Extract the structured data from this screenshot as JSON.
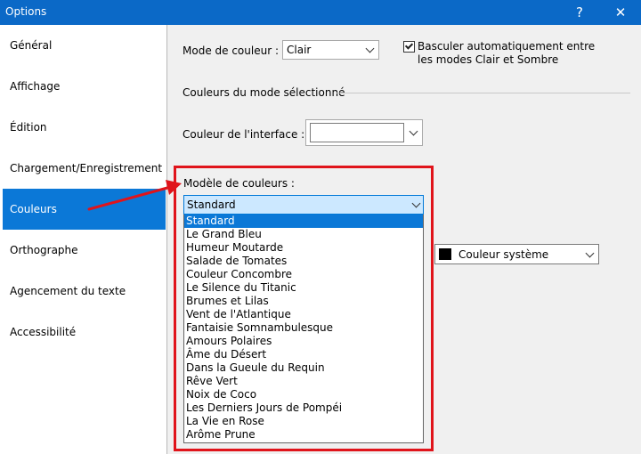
{
  "window": {
    "title": "Options",
    "help_label": "?",
    "close_label": "✕"
  },
  "sidebar": {
    "items": [
      {
        "label": "Général"
      },
      {
        "label": "Affichage"
      },
      {
        "label": "Édition"
      },
      {
        "label": "Chargement/Enregistrement"
      },
      {
        "label": "Couleurs"
      },
      {
        "label": "Orthographe"
      },
      {
        "label": "Agencement du texte"
      },
      {
        "label": "Accessibilité"
      }
    ],
    "active_index": 4
  },
  "color_mode": {
    "label": "Mode de couleur :",
    "value": "Clair",
    "auto_switch_checked": true,
    "auto_switch_line1": "Basculer automatiquement entre",
    "auto_switch_line2": "les modes Clair et Sombre"
  },
  "section": {
    "title": "Couleurs du mode sélectionné"
  },
  "interface_color": {
    "label": "Couleur de l'interface :",
    "value": "#ffffff"
  },
  "color_model": {
    "label": "Modèle de couleurs :",
    "value": "Standard",
    "options": [
      "Standard",
      "Le Grand Bleu",
      "Humeur Moutarde",
      "Salade de Tomates",
      "Couleur Concombre",
      "Le Silence du Titanic",
      "Brumes et Lilas",
      "Vent de l'Atlantique",
      "Fantaisie Somnambulesque",
      "Amours Polaires",
      "Âme du Désert",
      "Dans la Gueule du Requin",
      "Rêve Vert",
      "Noix de Coco",
      "Les Derniers Jours de Pompéi",
      "La Vie en Rose",
      "Arôme Prune"
    ],
    "selected_index": 0
  },
  "system_color": {
    "label": "Couleur système",
    "swatch": "#000000"
  },
  "colors": {
    "accent": "#0b78d7",
    "titlebar": "#0b69c7",
    "highlight": "#e0141b"
  }
}
